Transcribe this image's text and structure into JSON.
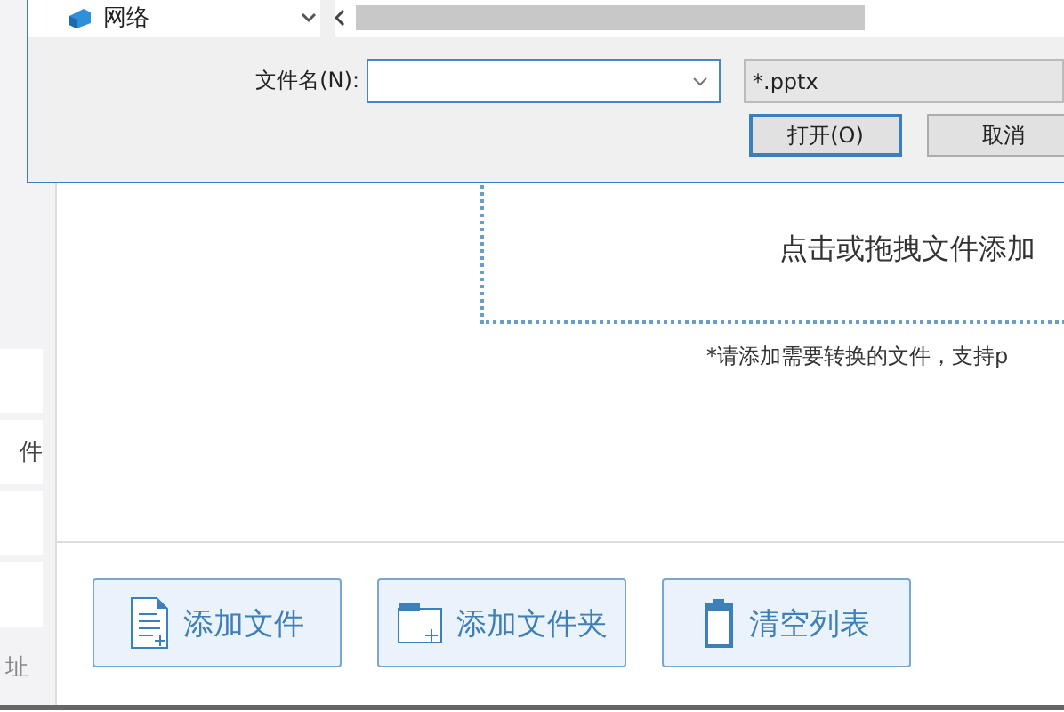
{
  "sidebar": {
    "items": [
      {
        "kind": "blank"
      },
      {
        "kind": "text",
        "label": "件"
      },
      {
        "kind": "blank"
      },
      {
        "kind": "blank"
      }
    ],
    "footer": "址"
  },
  "drop_zone": {
    "prompt": "点击或拖拽文件添加",
    "hint": "*请添加需要转换的文件，支持p"
  },
  "actions": [
    {
      "kind": "file",
      "label": "添加文件"
    },
    {
      "kind": "folder",
      "label": "添加文件夹"
    },
    {
      "kind": "clear",
      "label": "清空列表"
    }
  ],
  "dialog": {
    "nav_item": "网络",
    "filename_label": "文件名(N):",
    "filter": "*.pptx",
    "buttons": [
      {
        "label": "打开(O)",
        "default": true
      },
      {
        "label": "取消",
        "default": false
      }
    ]
  }
}
